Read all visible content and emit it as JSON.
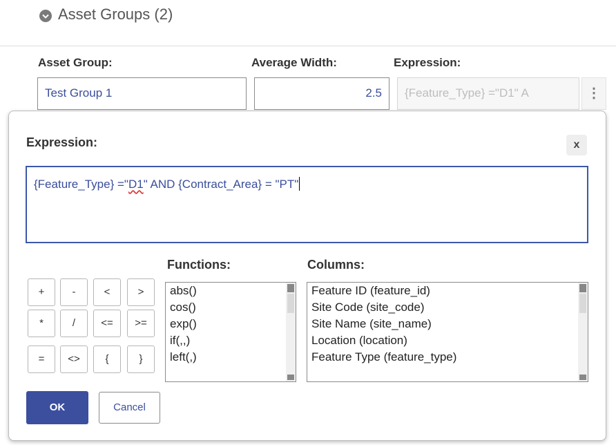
{
  "section": {
    "title": "Asset Groups (2)",
    "icon": "chevron-down-circle-icon"
  },
  "form": {
    "asset_group_label": "Asset Group:",
    "asset_group_value": "Test Group 1",
    "average_width_label": "Average Width:",
    "average_width_value": "2.5",
    "expression_label": "Expression:",
    "expression_value": "{Feature_Type} =\"D1\" A",
    "menu_icon": "kebab-menu-icon",
    "menu_glyph": "⋮"
  },
  "dialog": {
    "title": "Expression:",
    "close_label": "x",
    "expression_pre": "{Feature_Type} =\"",
    "expression_flagged": "D1",
    "expression_post": "\" AND {Contract_Area} = \"PT\"",
    "functions_label": "Functions:",
    "columns_label": "Columns:",
    "operators": [
      "+",
      "-",
      "<",
      ">",
      "*",
      "/",
      "<=",
      ">=",
      "=",
      "<>",
      "{",
      "}"
    ],
    "functions": [
      "abs()",
      "cos()",
      "exp()",
      "if(,,)",
      "left(,)"
    ],
    "columns": [
      "Feature ID (feature_id)",
      "Site Code (site_code)",
      "Site Name (site_name)",
      "Location (location)",
      "Feature Type (feature_type)"
    ],
    "ok_label": "OK",
    "cancel_label": "Cancel"
  },
  "colors": {
    "accent": "#3b4f9e",
    "value_text": "#3a4e9c",
    "spell_error": "#dd3333"
  }
}
